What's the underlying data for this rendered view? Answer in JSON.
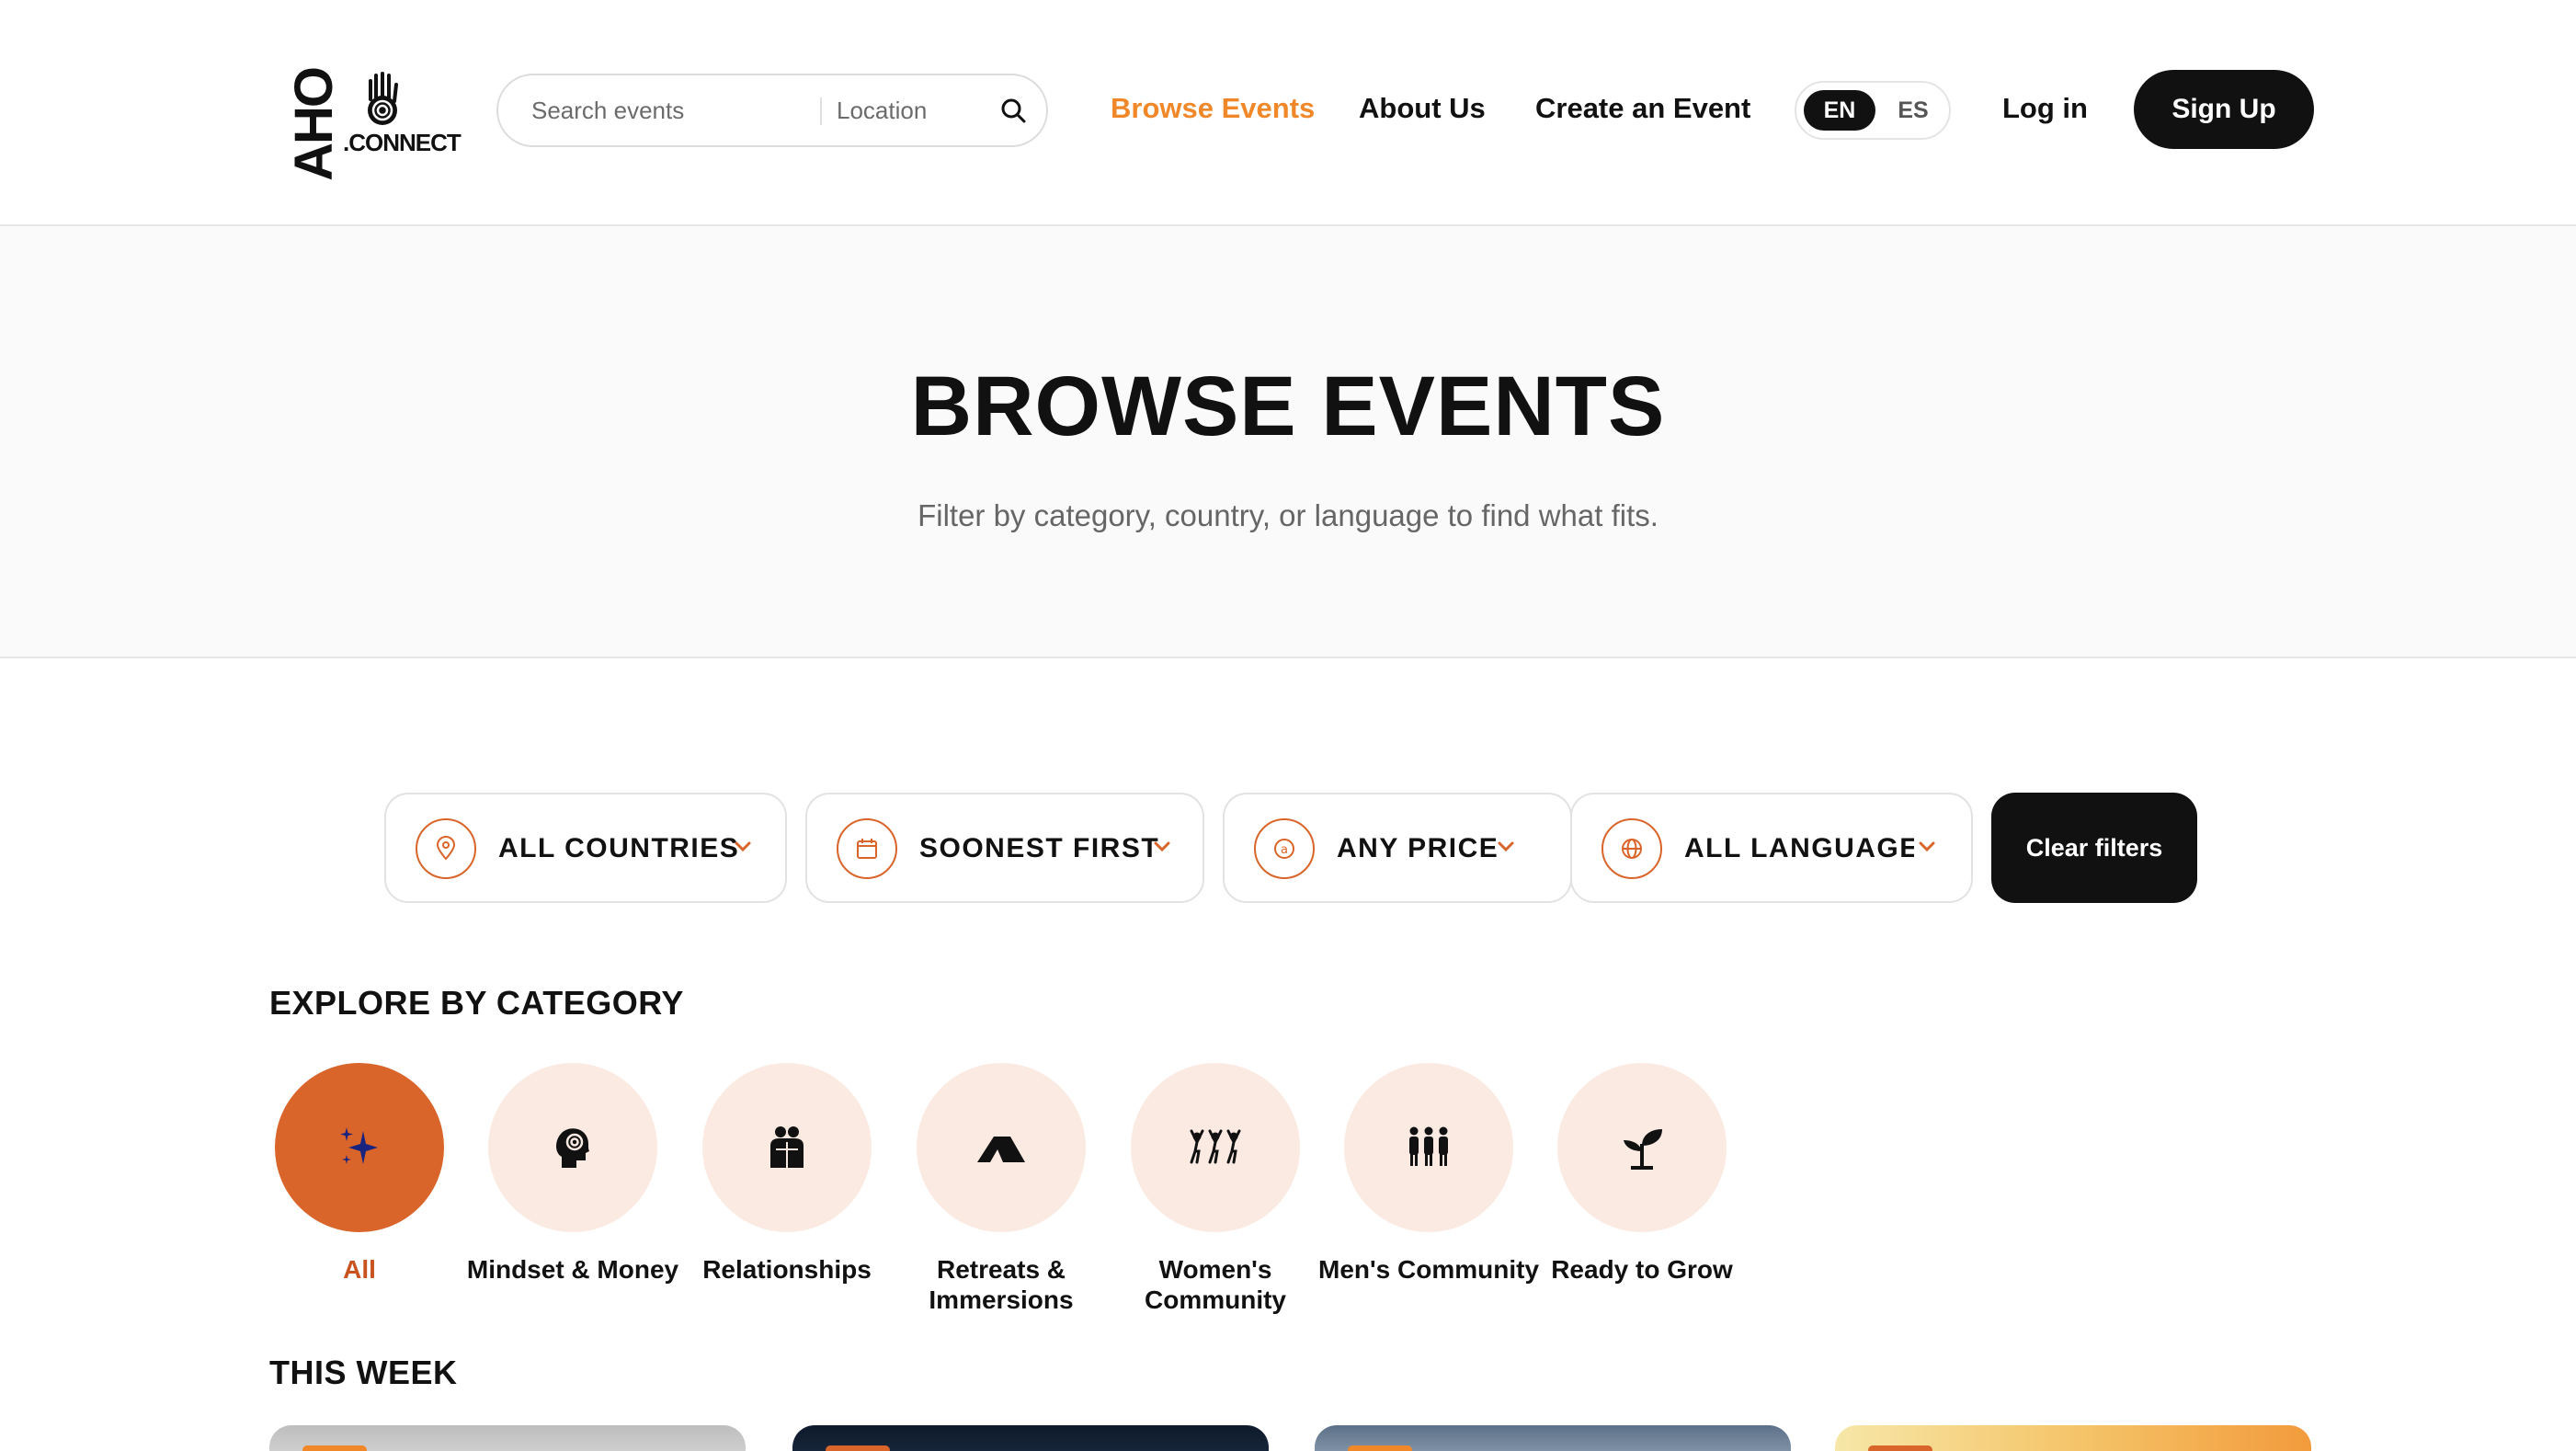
{
  "header": {
    "logo_mark": "AHO",
    "logo_sub": ".CONNECT",
    "search_placeholder": "Search events",
    "location_placeholder": "Location",
    "nav": [
      {
        "label": "Browse Events",
        "active": true
      },
      {
        "label": "About Us",
        "active": false
      },
      {
        "label": "Create an Event",
        "active": false
      }
    ],
    "lang": {
      "en": "EN",
      "es": "ES",
      "selected": "EN"
    },
    "login": "Log in",
    "signup": "Sign Up"
  },
  "hero": {
    "title": "BROWSE EVENTS",
    "subtitle": "Filter by category, country, or language to find what fits."
  },
  "filters": [
    {
      "label": "ALL COUNTRIES",
      "icon": "map-pin-icon"
    },
    {
      "label": "SOONEST FIRST",
      "icon": "calendar-icon"
    },
    {
      "label": "ANY PRICE",
      "icon": "price-tag-icon"
    },
    {
      "label": "ALL LANGUAGES",
      "icon": "globe-icon"
    }
  ],
  "clear_filters": "Clear filters",
  "categories_title": "EXPLORE BY CATEGORY",
  "categories": [
    {
      "label": "All",
      "icon": "sparkles-icon",
      "selected": true
    },
    {
      "label": "Mindset & Money",
      "icon": "head-spiral-icon",
      "selected": false
    },
    {
      "label": "Relationships",
      "icon": "people-hug-icon",
      "selected": false
    },
    {
      "label": "Retreats & Immersions",
      "icon": "tent-icon",
      "selected": false
    },
    {
      "label": "Women's Community",
      "icon": "dancing-women-icon",
      "selected": false
    },
    {
      "label": "Men's Community",
      "icon": "men-group-icon",
      "selected": false
    },
    {
      "label": "Ready to Grow",
      "icon": "sprout-icon",
      "selected": false
    }
  ],
  "this_week_title": "THIS WEEK",
  "colors": {
    "accent": "#f0882a",
    "brand_orange": "#d9652a",
    "category_bg": "#fbeae2",
    "dark": "#111111"
  }
}
